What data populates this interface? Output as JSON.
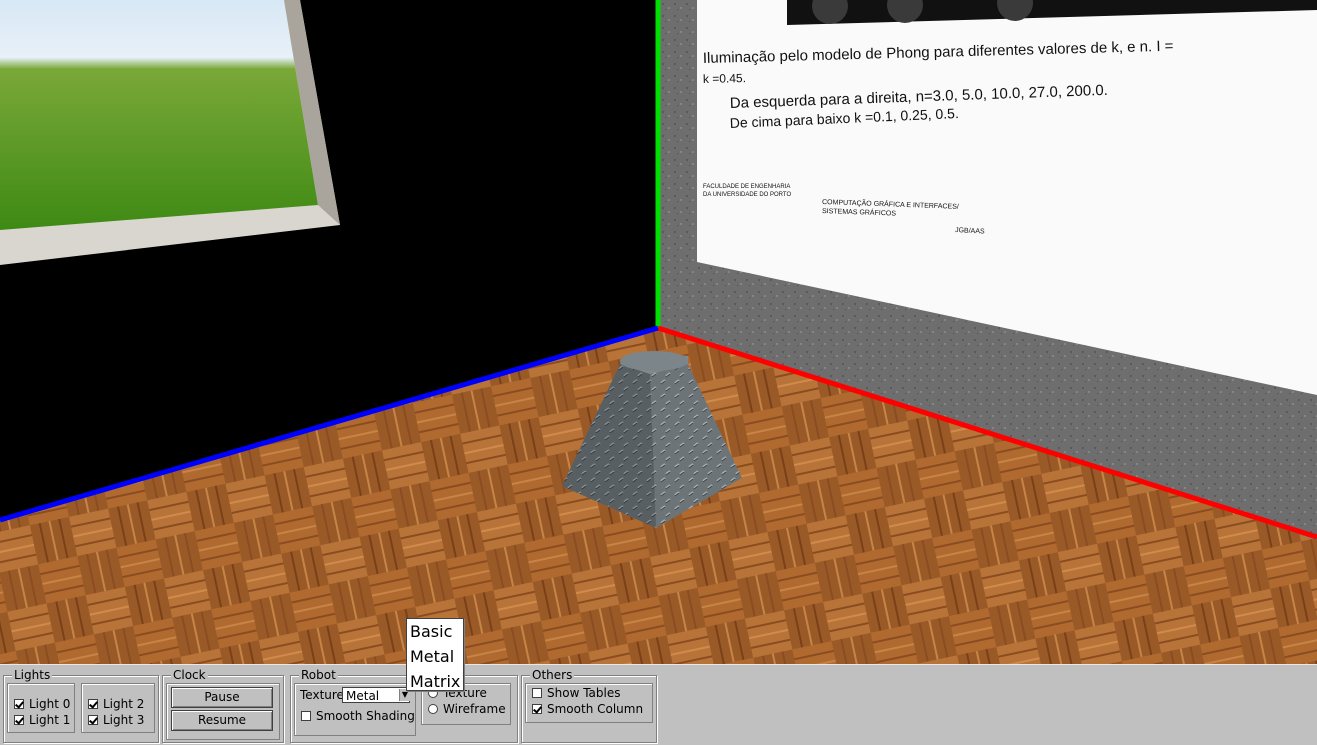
{
  "poster": {
    "line1": "Iluminação pelo modelo de Phong para diferentes valores de k, e n. I =",
    "line2": "k =0.45.",
    "line3": "Da esquerda para a direita, n=3.0, 5.0, 10.0, 27.0, 200.0.",
    "line4": "De cima para baixo k =0.1, 0.25, 0.5.",
    "footer_left_1": "FACULDADE DE ENGENHARIA",
    "footer_left_2": "DA UNIVERSIDADE DO PORTO",
    "footer_mid_1": "COMPUTAÇÃO GRÁFICA E INTERFACES/",
    "footer_mid_2": "SISTEMAS GRÁFICOS",
    "footer_right": "JGB/AAS"
  },
  "colors": {
    "axis_x": "#ff0000",
    "axis_y": "#00e000",
    "axis_z": "#0000ff",
    "panel_bg": "#c0c0c0"
  },
  "panel": {
    "lights": {
      "title": "Lights",
      "items": [
        {
          "label": "Light 0",
          "checked": true
        },
        {
          "label": "Light 1",
          "checked": true
        },
        {
          "label": "Light 2",
          "checked": true
        },
        {
          "label": "Light 3",
          "checked": true
        }
      ]
    },
    "clock": {
      "title": "Clock",
      "pause_label": "Pause",
      "resume_label": "Resume"
    },
    "robot": {
      "title": "Robot",
      "texture_label": "Texture",
      "texture_value": "Metal",
      "smooth_shading_label": "Smooth Shading",
      "smooth_shading_checked": false,
      "radio_texture_label": "Texture",
      "radio_wireframe_label": "Wireframe"
    },
    "others": {
      "title": "Others",
      "show_tables_label": "Show Tables",
      "show_tables_checked": false,
      "smooth_column_label": "Smooth Column",
      "smooth_column_checked": true
    }
  },
  "dropdown": {
    "options": [
      "Basic",
      "Metal",
      "Matrix"
    ]
  }
}
